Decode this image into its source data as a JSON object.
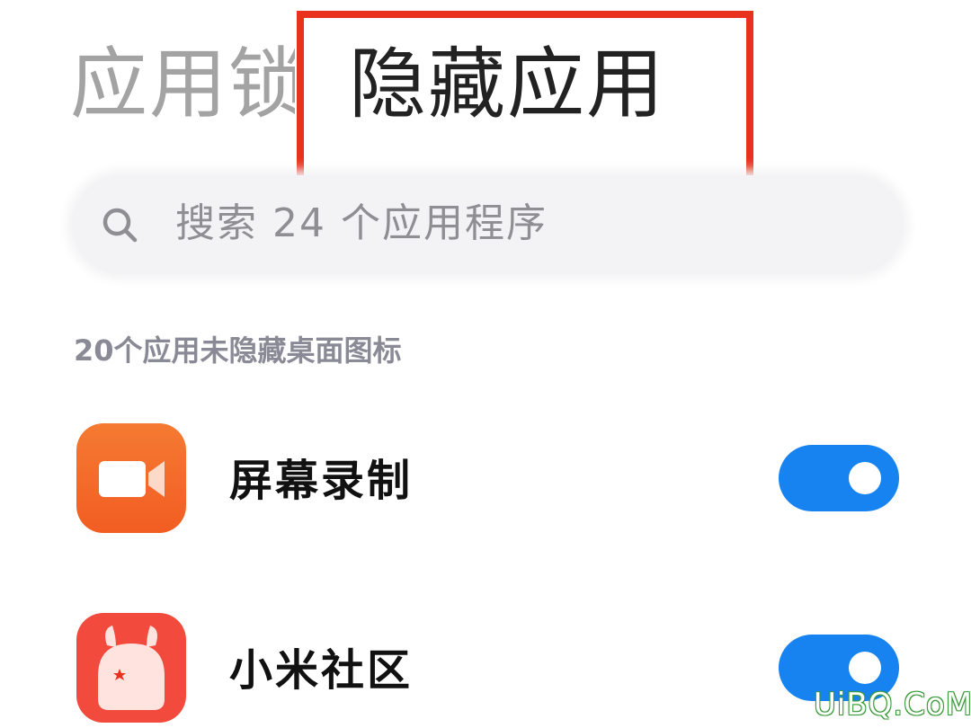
{
  "tabs": {
    "app_lock": "应用锁",
    "hidden_apps": "隐藏应用",
    "active": "hidden_apps"
  },
  "highlight": {
    "color": "#e8321e"
  },
  "search": {
    "placeholder": "搜索 24 个应用程序",
    "icon": "search-icon"
  },
  "section": {
    "header": "20个应用未隐藏桌面图标"
  },
  "apps": [
    {
      "name": "屏幕录制",
      "icon": "video-camera-icon",
      "icon_color": "#f46a2a",
      "toggle_on": true
    },
    {
      "name": "小米社区",
      "icon": "mi-bunny-icon",
      "icon_color": "#f24b3e",
      "toggle_on": true
    }
  ],
  "colors": {
    "toggle_on": "#1683f0",
    "tab_active": "#222222",
    "tab_inactive": "#a3a3a3"
  },
  "watermark": "UiBQ.CoM"
}
